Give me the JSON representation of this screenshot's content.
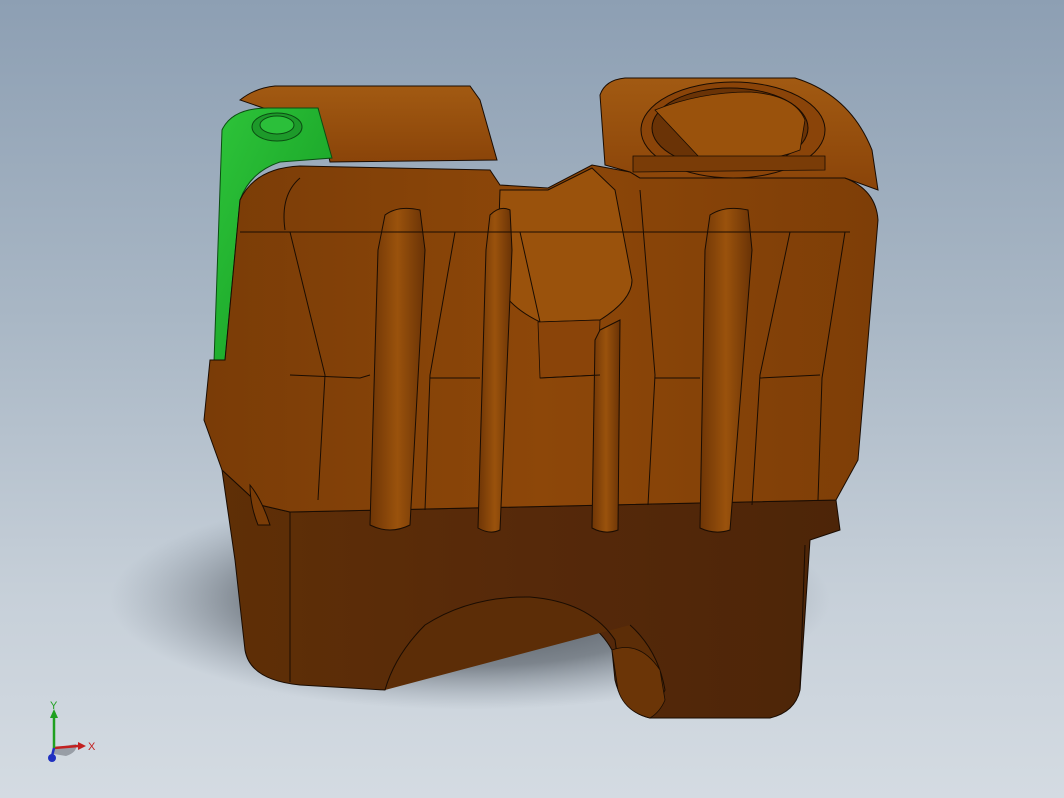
{
  "viewport": {
    "background_top": "#8d9fb3",
    "background_bottom": "#d4dbe2"
  },
  "model": {
    "body_color": "#8a4408",
    "body_dark_color": "#5a2c08",
    "selected_face_color": "#1fae2c",
    "edge_color": "#1a0c02"
  },
  "triad": {
    "x_label": "X",
    "y_label": "Y",
    "x_color": "#c22020",
    "y_color": "#20a020",
    "z_color": "#2030c0"
  }
}
